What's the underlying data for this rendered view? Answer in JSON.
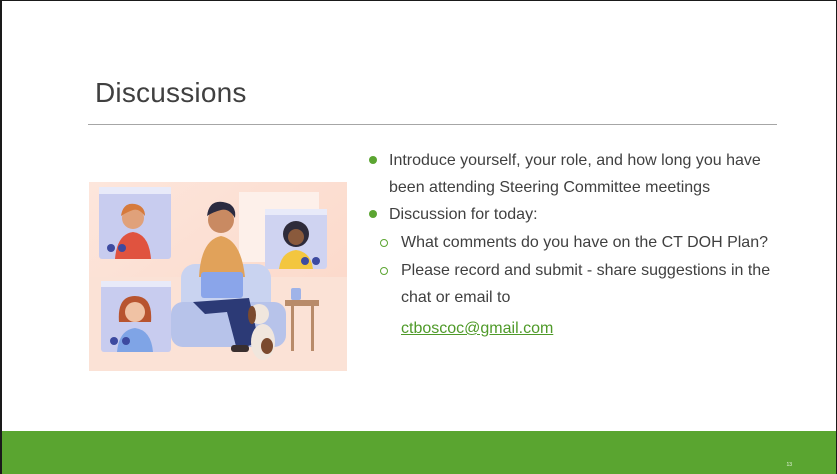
{
  "slide": {
    "title": "Discussions",
    "bullets": [
      "Introduce yourself, your role, and how long you have been attending Steering Committee meetings",
      "Discussion for today:"
    ],
    "sub_bullets": [
      "What comments do you have on the CT DOH Plan?",
      "Please record and submit - share suggestions in the chat or email to"
    ],
    "email_link": "ctboscoc@gmail.com",
    "page_number": "13"
  },
  "colors": {
    "accent": "#5ba531",
    "footer": "#5aa530",
    "text": "#404040",
    "link": "#4f9a29"
  },
  "illustration": {
    "icon": "video-conference-illustration"
  }
}
